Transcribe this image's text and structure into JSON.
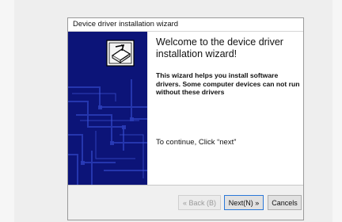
{
  "window": {
    "title": "Device driver installation wizard"
  },
  "welcome": {
    "heading": "Welcome to the device driver installation wizard!",
    "description": "This wizard helps you install software drivers. Some computer devices can not run without these drivers",
    "instruction": "To continue, Click “next”"
  },
  "buttons": {
    "back": "« Back (B)",
    "next": "Next(N) »",
    "cancel": "Cancels"
  },
  "icons": {
    "side_panel": "installer-box-icon"
  },
  "colors": {
    "side_panel": "#0c1478",
    "focus_border": "#2b78d8"
  }
}
